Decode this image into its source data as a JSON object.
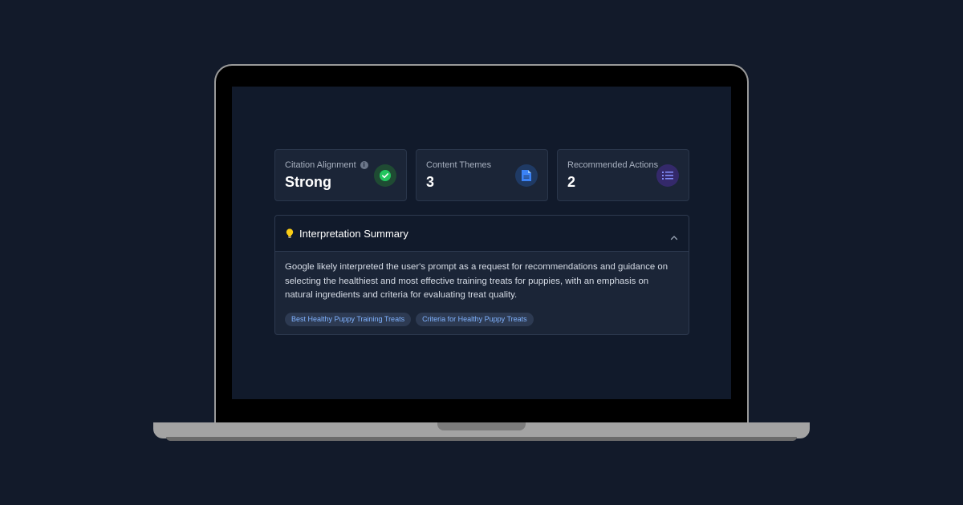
{
  "stats": [
    {
      "label": "Citation Alignment",
      "value": "Strong",
      "icon": "check-circle-icon",
      "color": "#22c55e",
      "has_info": true
    },
    {
      "label": "Content Themes",
      "value": "3",
      "icon": "document-icon",
      "color": "#3b82f6"
    },
    {
      "label": "Recommended Actions",
      "value": "2",
      "icon": "list-icon",
      "color": "#6366f1"
    }
  ],
  "summary": {
    "title": "Interpretation Summary",
    "icon": "lightbulb-icon",
    "text": "Google likely interpreted the user's prompt as a request for recommendations and guidance on selecting the healthiest and most effective training treats for puppies, with an emphasis on natural ingredients and criteria for evaluating treat quality.",
    "tags": [
      "Best Healthy Puppy Training Treats",
      "Criteria for Healthy Puppy Treats"
    ]
  }
}
